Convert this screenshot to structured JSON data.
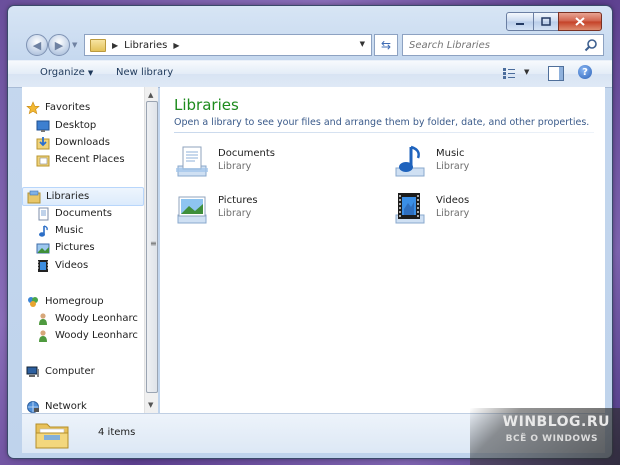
{
  "window": {
    "controls": [
      "minimize",
      "maximize",
      "close"
    ]
  },
  "address_bar": {
    "path": "Libraries",
    "search_placeholder": "Search Libraries"
  },
  "toolbar": {
    "organize_label": "Organize",
    "new_library_label": "New library"
  },
  "nav_pane": {
    "favorites": {
      "label": "Favorites",
      "icon": "star-icon"
    },
    "favorites_items": [
      {
        "label": "Desktop",
        "icon": "desktop-icon"
      },
      {
        "label": "Downloads",
        "icon": "downloads-icon"
      },
      {
        "label": "Recent Places",
        "icon": "recent-places-icon"
      }
    ],
    "libraries": {
      "label": "Libraries",
      "icon": "libraries-icon"
    },
    "libraries_items": [
      {
        "label": "Documents",
        "icon": "documents-icon"
      },
      {
        "label": "Music",
        "icon": "music-icon"
      },
      {
        "label": "Pictures",
        "icon": "pictures-icon"
      },
      {
        "label": "Videos",
        "icon": "videos-icon"
      }
    ],
    "homegroup": {
      "label": "Homegroup",
      "icon": "homegroup-icon"
    },
    "homegroup_items": [
      {
        "label": "Woody Leonharc",
        "icon": "user-icon"
      },
      {
        "label": "Woody Leonharc",
        "icon": "user-icon"
      }
    ],
    "computer": {
      "label": "Computer",
      "icon": "computer-icon"
    },
    "network": {
      "label": "Network",
      "icon": "network-icon"
    }
  },
  "content": {
    "title": "Libraries",
    "description": "Open a library to see your files and arrange them by folder, date, and other properties.",
    "libraries": [
      {
        "name": "Documents",
        "type": "Library",
        "icon": "documents-library-icon"
      },
      {
        "name": "Music",
        "type": "Library",
        "icon": "music-library-icon"
      },
      {
        "name": "Pictures",
        "type": "Library",
        "icon": "pictures-library-icon"
      },
      {
        "name": "Videos",
        "type": "Library",
        "icon": "videos-library-icon"
      }
    ]
  },
  "status": {
    "item_count": "4 items"
  },
  "watermark": {
    "line1": "WINBLOG.RU",
    "line2": "ВСЁ О WINDOWS"
  },
  "colors": {
    "title_green": "#1d8b1d",
    "link_blue": "#3a5a8a",
    "background_purple": "#6a4f9c"
  }
}
